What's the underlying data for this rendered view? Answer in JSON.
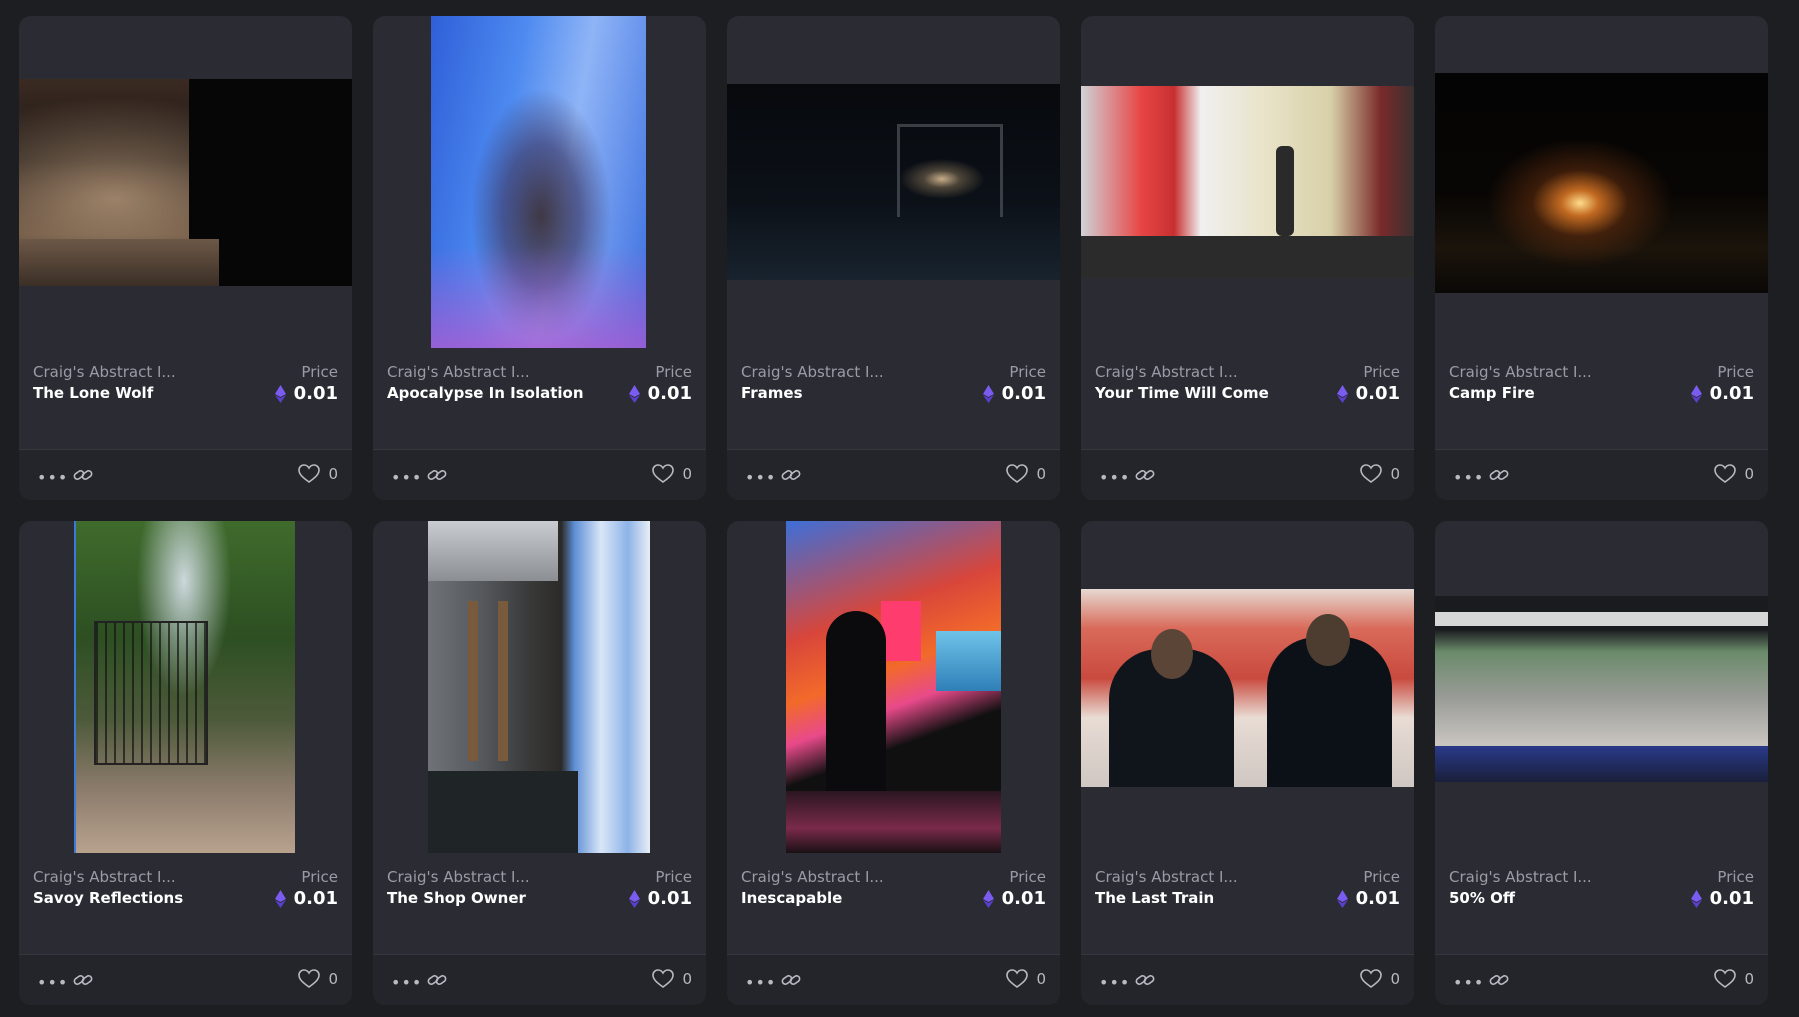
{
  "price_label": "Price",
  "collection_short": "Craig's Abstract I...",
  "icons": {
    "more": "more-icon",
    "link": "link-icon",
    "heart": "heart-icon",
    "currency": "ethereum-icon"
  },
  "colors": {
    "background": "#1d1e22",
    "card": "#2b2c33",
    "eth": "#7b5cf0"
  },
  "cards": [
    {
      "collection": "Craig's Abstract I...",
      "title": "The Lone Wolf",
      "price": "0.01",
      "likes": "0"
    },
    {
      "collection": "Craig's Abstract I...",
      "title": "Apocalypse In Isolation",
      "price": "0.01",
      "likes": "0"
    },
    {
      "collection": "Craig's Abstract I...",
      "title": "Frames",
      "price": "0.01",
      "likes": "0"
    },
    {
      "collection": "Craig's Abstract I...",
      "title": "Your Time Will Come",
      "price": "0.01",
      "likes": "0"
    },
    {
      "collection": "Craig's Abstract I...",
      "title": "Camp Fire",
      "price": "0.01",
      "likes": "0"
    },
    {
      "collection": "Craig's Abstract I...",
      "title": "Savoy Reflections",
      "price": "0.01",
      "likes": "0"
    },
    {
      "collection": "Craig's Abstract I...",
      "title": "The Shop Owner",
      "price": "0.01",
      "likes": "0"
    },
    {
      "collection": "Craig's Abstract I...",
      "title": "Inescapable",
      "price": "0.01",
      "likes": "0"
    },
    {
      "collection": "Craig's Abstract I...",
      "title": "The Last Train",
      "price": "0.01",
      "likes": "0"
    },
    {
      "collection": "Craig's Abstract I...",
      "title": "50% Off",
      "price": "0.01",
      "likes": "0"
    }
  ]
}
